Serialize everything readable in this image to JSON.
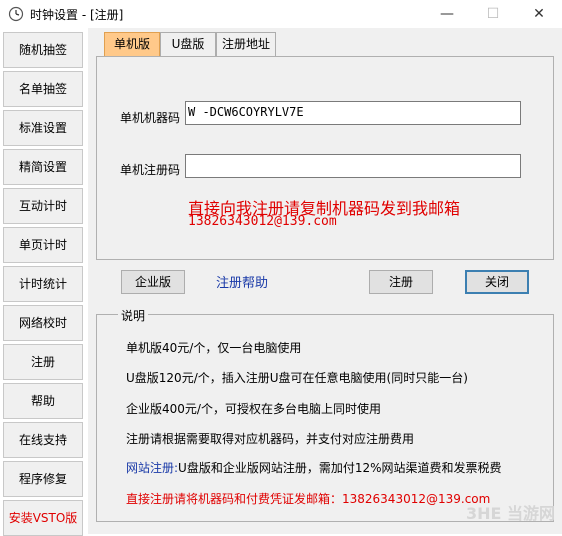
{
  "window": {
    "title": "时钟设置 - [注册]",
    "min": "—",
    "max": "☐",
    "close": "✕"
  },
  "sidebar": {
    "items": [
      {
        "label": "随机抽签"
      },
      {
        "label": "名单抽签"
      },
      {
        "label": "标准设置"
      },
      {
        "label": "精简设置"
      },
      {
        "label": "互动计时"
      },
      {
        "label": "单页计时"
      },
      {
        "label": "计时统计"
      },
      {
        "label": "网络校时"
      },
      {
        "label": "注册"
      },
      {
        "label": "帮助"
      },
      {
        "label": "在线支持"
      },
      {
        "label": "程序修复"
      },
      {
        "label": "安装VSTO版"
      }
    ]
  },
  "tabs": [
    {
      "label": "单机版"
    },
    {
      "label": "U盘版"
    },
    {
      "label": "注册地址"
    }
  ],
  "form": {
    "machine_code_label": "单机机器码",
    "machine_code_value": "W -DCW6COYRYLV7E",
    "reg_code_label": "单机注册码",
    "reg_code_value": "",
    "notice_line1": "直接向我注册请复制机器码发到我邮箱",
    "notice_line2": "13826343012@139.com"
  },
  "buttons": {
    "enterprise": "企业版",
    "help_link": "注册帮助",
    "register": "注册",
    "close": "关闭"
  },
  "info": {
    "legend": "说明",
    "line1": "单机版40元/个，仅一台电脑使用",
    "line2": "U盘版120元/个，插入注册U盘可在任意电脑使用(同时只能一台)",
    "line3": "企业版400元/个，可授权在多台电脑上同时使用",
    "line4": "注册请根据需要取得对应机器码，并支付对应注册费用",
    "line5_prefix": "网站注册:",
    "line5_rest": "U盘版和企业版网站注册，需加付12%网站渠道费和发票税费",
    "line6": "直接注册请将机器码和付费凭证发邮箱：13826343012@139.com"
  },
  "watermark": "3HE 当游网",
  "colors": {
    "accent_red": "#e00000",
    "link_blue": "#1a3aa8",
    "active_tab": "#ffc98a"
  }
}
